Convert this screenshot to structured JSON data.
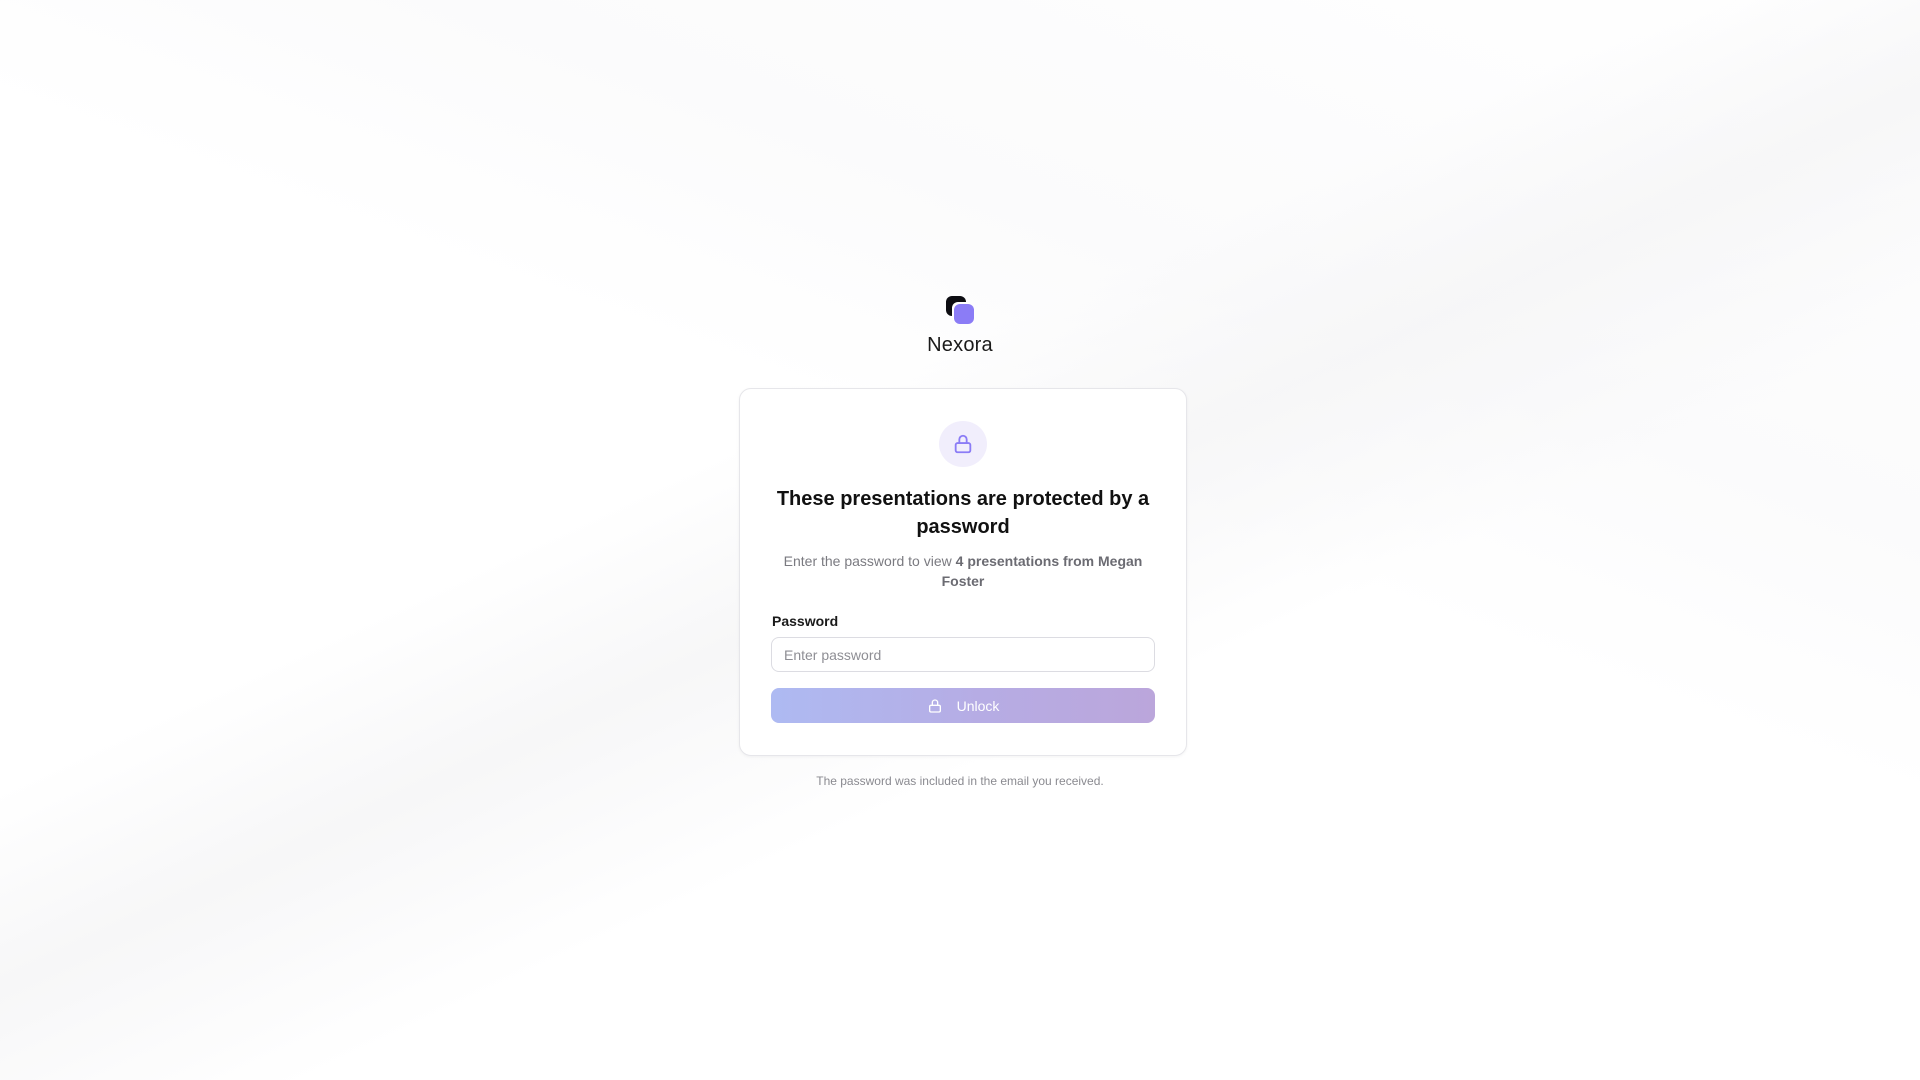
{
  "brand": {
    "name": "Nexora",
    "logo_icon": "stacked-squares-logo-icon",
    "colors": {
      "logo_back": "#0d0d12",
      "logo_front": "#8b7cf6"
    }
  },
  "card": {
    "icon": "lock-icon",
    "title": "These presentations are protected by a password",
    "subtitle_prefix": "Enter the password to view ",
    "subtitle_highlight": "4 presentations from Megan Foster",
    "password_label": "Password",
    "password_placeholder": "Enter password",
    "password_value": "",
    "unlock_label": "Unlock",
    "unlock_icon": "lock-icon",
    "colors": {
      "accent": "#8b7cf6",
      "icon_badge_bg": "#f1eefc",
      "button_gradient_start": "#aebaf2",
      "button_gradient_end": "#bba6db"
    }
  },
  "footnote": "The password was included in the email you received."
}
